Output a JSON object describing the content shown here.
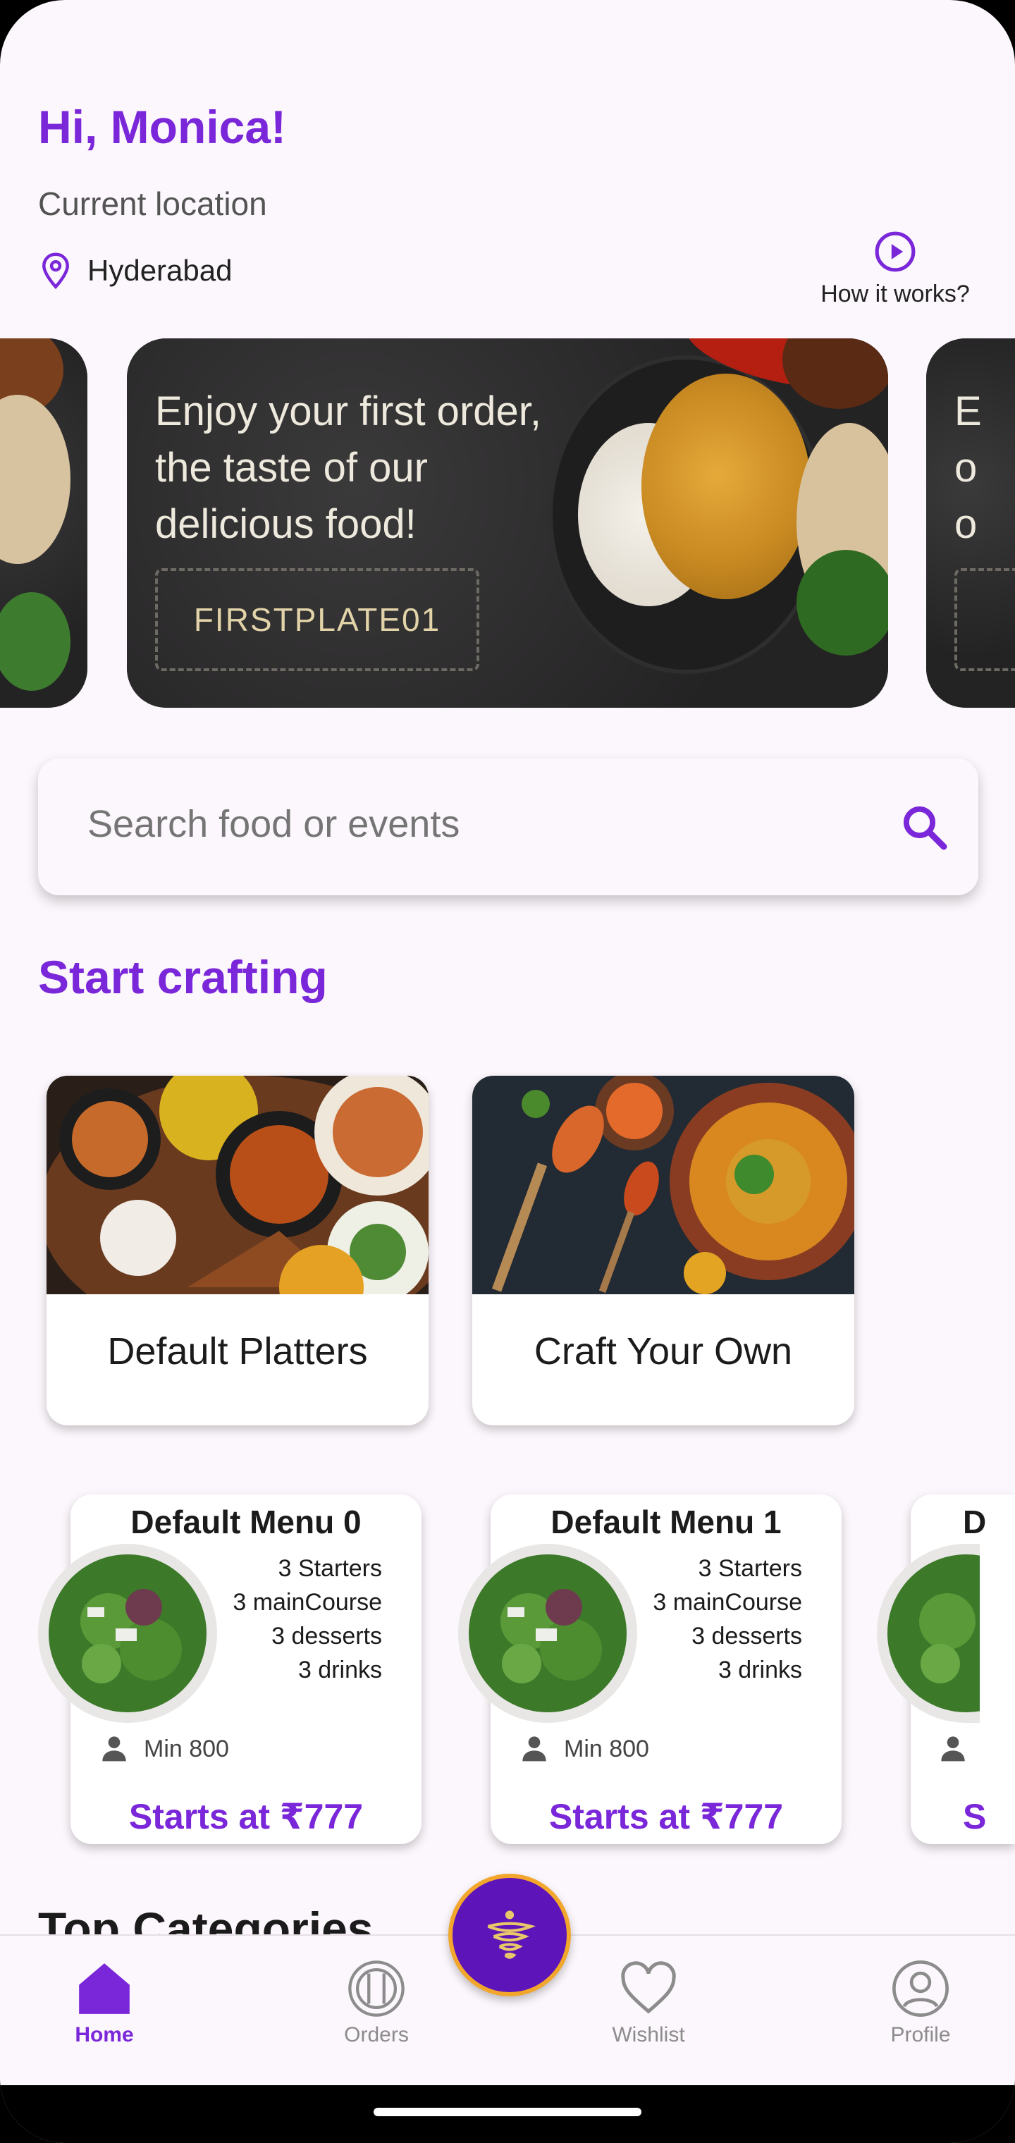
{
  "header": {
    "greeting": "Hi, Monica!",
    "location_label": "Current location",
    "location_city": "Hyderabad",
    "how_it_works": "How it works?"
  },
  "banner": {
    "text": "Enjoy your first order, the taste of our delicious food!",
    "coupon_code": "FIRSTPLATE01"
  },
  "search": {
    "placeholder": "Search food or events"
  },
  "start_crafting": {
    "title": "Start crafting",
    "cards": [
      {
        "label": "Default Platters"
      },
      {
        "label": "Craft Your Own"
      }
    ]
  },
  "menus": [
    {
      "title": "Default Menu 0",
      "lines": [
        "3 Starters",
        "3 mainCourse",
        "3 desserts",
        "3 drinks"
      ],
      "min": "Min 800",
      "price": "Starts at ₹777"
    },
    {
      "title": "Default Menu 1",
      "lines": [
        "3 Starters",
        "3 mainCourse",
        "3 desserts",
        "3 drinks"
      ],
      "min": "Min 800",
      "price": "Starts at ₹777"
    }
  ],
  "next_section": {
    "title": "Top Categories"
  },
  "nav": {
    "items": [
      {
        "label": "Home",
        "icon": "home-icon",
        "active": true
      },
      {
        "label": "Orders",
        "icon": "plate-cutlery-icon",
        "active": false
      },
      {
        "label": "Wishlist",
        "icon": "heart-icon",
        "active": false
      },
      {
        "label": "Profile",
        "icon": "user-circle-icon",
        "active": false
      }
    ],
    "center_icon": "brand-logo-icon"
  },
  "colors": {
    "accent": "#7a26d9",
    "fab": "#5d14b8",
    "fab_ring": "#f2a72c"
  }
}
